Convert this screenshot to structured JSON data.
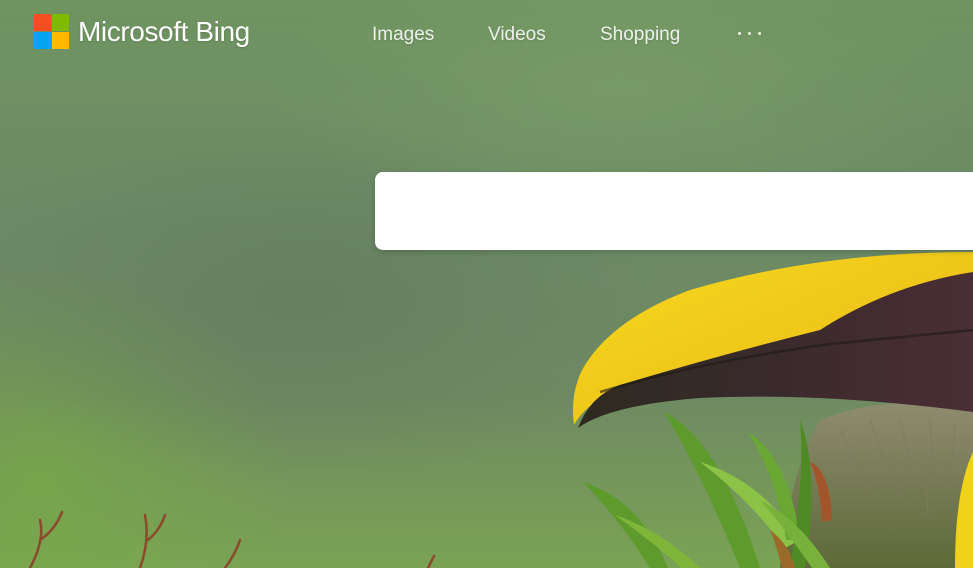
{
  "brand": {
    "name": "Microsoft Bing",
    "logo_icon": "microsoft-four-squares-icon",
    "logo_colors": [
      "#f25022",
      "#7fba00",
      "#00a4ef",
      "#ffb900"
    ]
  },
  "nav": {
    "items": [
      {
        "label": "Images"
      },
      {
        "label": "Videos"
      },
      {
        "label": "Shopping"
      }
    ],
    "more_icon": "more-dots-icon"
  },
  "search": {
    "value": "",
    "placeholder": ""
  },
  "background": {
    "subject": "toucan-beak-image",
    "colors": {
      "foliage": "#6f8f60",
      "beak_yellow": "#f2cc1c",
      "beak_dark": "#3b2a2c"
    }
  }
}
